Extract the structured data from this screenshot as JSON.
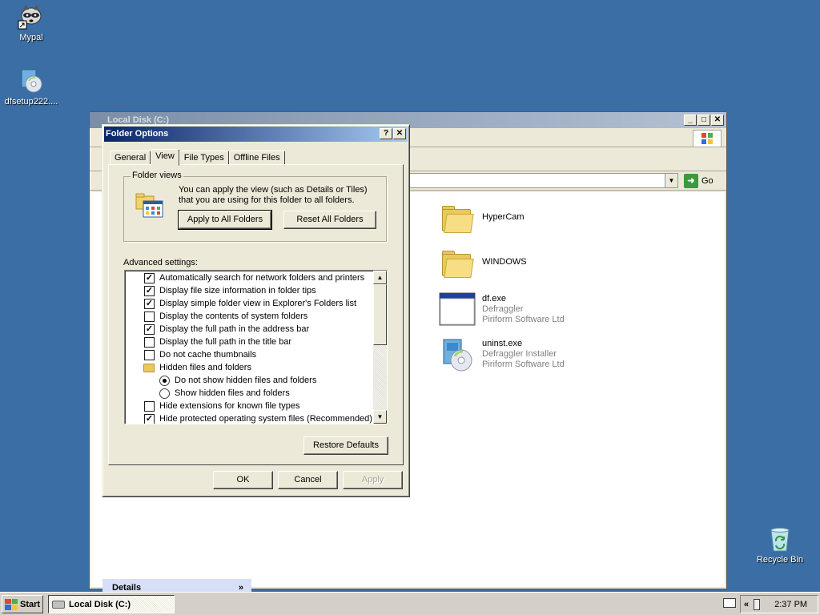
{
  "desktop": {
    "icons": [
      {
        "label": "Mypal",
        "icon": "mypal-raccoon-icon"
      },
      {
        "label": "dfsetup222....",
        "icon": "setup-disc-icon"
      },
      {
        "label": "Recycle Bin",
        "icon": "recycle-bin-icon"
      }
    ]
  },
  "explorer": {
    "title": "Local Disk (C:)",
    "address_go": "Go",
    "details_label": "Details",
    "files": [
      {
        "name": "HyperCam",
        "icon": "folder-icon"
      },
      {
        "name": "WINDOWS",
        "icon": "folder-icon"
      },
      {
        "name": "df.exe",
        "line2": "Defraggler",
        "line3": "Piriform Software Ltd",
        "icon": "app-window-icon"
      },
      {
        "name": "uninst.exe",
        "line2": "Defraggler Installer",
        "line3": "Piriform Software Ltd",
        "icon": "installer-icon"
      }
    ]
  },
  "dialog": {
    "title": "Folder Options",
    "tabs": [
      {
        "label": "General",
        "active": false
      },
      {
        "label": "View",
        "active": true
      },
      {
        "label": "File Types",
        "active": false
      },
      {
        "label": "Offline Files",
        "active": false
      }
    ],
    "folder_views": {
      "legend": "Folder views",
      "description": "You can apply the view (such as Details or Tiles) that you are using for this folder to all folders.",
      "apply_all": "Apply to All Folders",
      "reset_all": "Reset All Folders"
    },
    "advanced_label": "Advanced settings:",
    "advanced_items": [
      {
        "type": "checkbox",
        "checked": true,
        "label": "Automatically search for network folders and printers"
      },
      {
        "type": "checkbox",
        "checked": true,
        "label": "Display file size information in folder tips"
      },
      {
        "type": "checkbox",
        "checked": true,
        "label": "Display simple folder view in Explorer's Folders list"
      },
      {
        "type": "checkbox",
        "checked": false,
        "label": "Display the contents of system folders"
      },
      {
        "type": "checkbox",
        "checked": true,
        "label": "Display the full path in the address bar"
      },
      {
        "type": "checkbox",
        "checked": false,
        "label": "Display the full path in the title bar"
      },
      {
        "type": "checkbox",
        "checked": false,
        "label": "Do not cache thumbnails"
      },
      {
        "type": "folder",
        "label": "Hidden files and folders"
      },
      {
        "type": "radio",
        "checked": true,
        "label": "Do not show hidden files and folders"
      },
      {
        "type": "radio",
        "checked": false,
        "label": "Show hidden files and folders"
      },
      {
        "type": "checkbox",
        "checked": false,
        "label": "Hide extensions for known file types"
      },
      {
        "type": "checkbox",
        "checked": true,
        "label": "Hide protected operating system files (Recommended)"
      }
    ],
    "restore_defaults": "Restore Defaults",
    "ok": "OK",
    "cancel": "Cancel",
    "apply": "Apply",
    "help_btn": "?",
    "close_btn": "✕"
  },
  "taskbar": {
    "start": "Start",
    "task": "Local Disk (C:)",
    "clock": "2:37 PM",
    "tray_chevron": "«"
  },
  "colors": {
    "desktop": "#3a6ea5",
    "dialog_title_start": "#0a246a",
    "dialog_title_end": "#a6caf0"
  }
}
